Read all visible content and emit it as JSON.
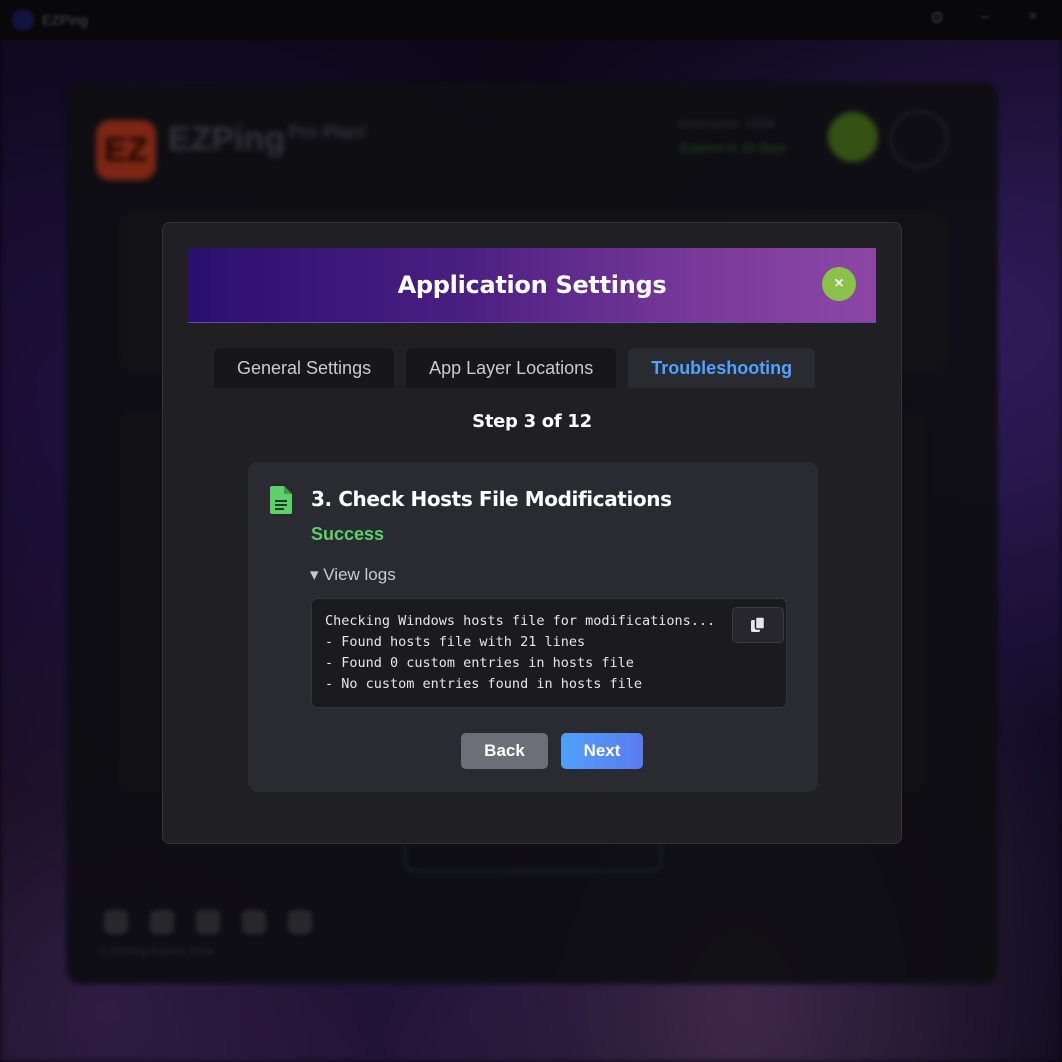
{
  "titlebar": {
    "app_name": "EZPing"
  },
  "background": {
    "brand": "EZPing",
    "plan": "Pro Plan!",
    "username": "Username: 5508",
    "expires": "Expires in 15 days",
    "copyright": "© EZPing Games 2024"
  },
  "modal": {
    "title": "Application Settings",
    "close_label": "×",
    "tabs": [
      {
        "label": "General Settings",
        "active": false
      },
      {
        "label": "App Layer Locations",
        "active": false
      },
      {
        "label": "Troubleshooting",
        "active": true
      }
    ],
    "step_label": "Step 3 of 12",
    "check": {
      "title": "3. Check Hosts File Modifications",
      "status": "Success",
      "logs_toggle": "▾ View logs",
      "log_lines": [
        "Checking Windows hosts file for modifications...",
        "- Found hosts file with 21 lines",
        "- Found 0 custom entries in hosts file",
        "- No custom entries found in hosts file"
      ]
    },
    "buttons": {
      "back": "Back",
      "next": "Next"
    }
  },
  "colors": {
    "accent_blue": "#4da3ff",
    "success_green": "#5fcf6b",
    "close_green": "#8bc34a",
    "header_gradient_start": "#2a0f6e",
    "header_gradient_end": "#8c47a6"
  },
  "icons": {
    "close": "close-icon",
    "document": "document-icon",
    "copy": "copy-icon"
  }
}
